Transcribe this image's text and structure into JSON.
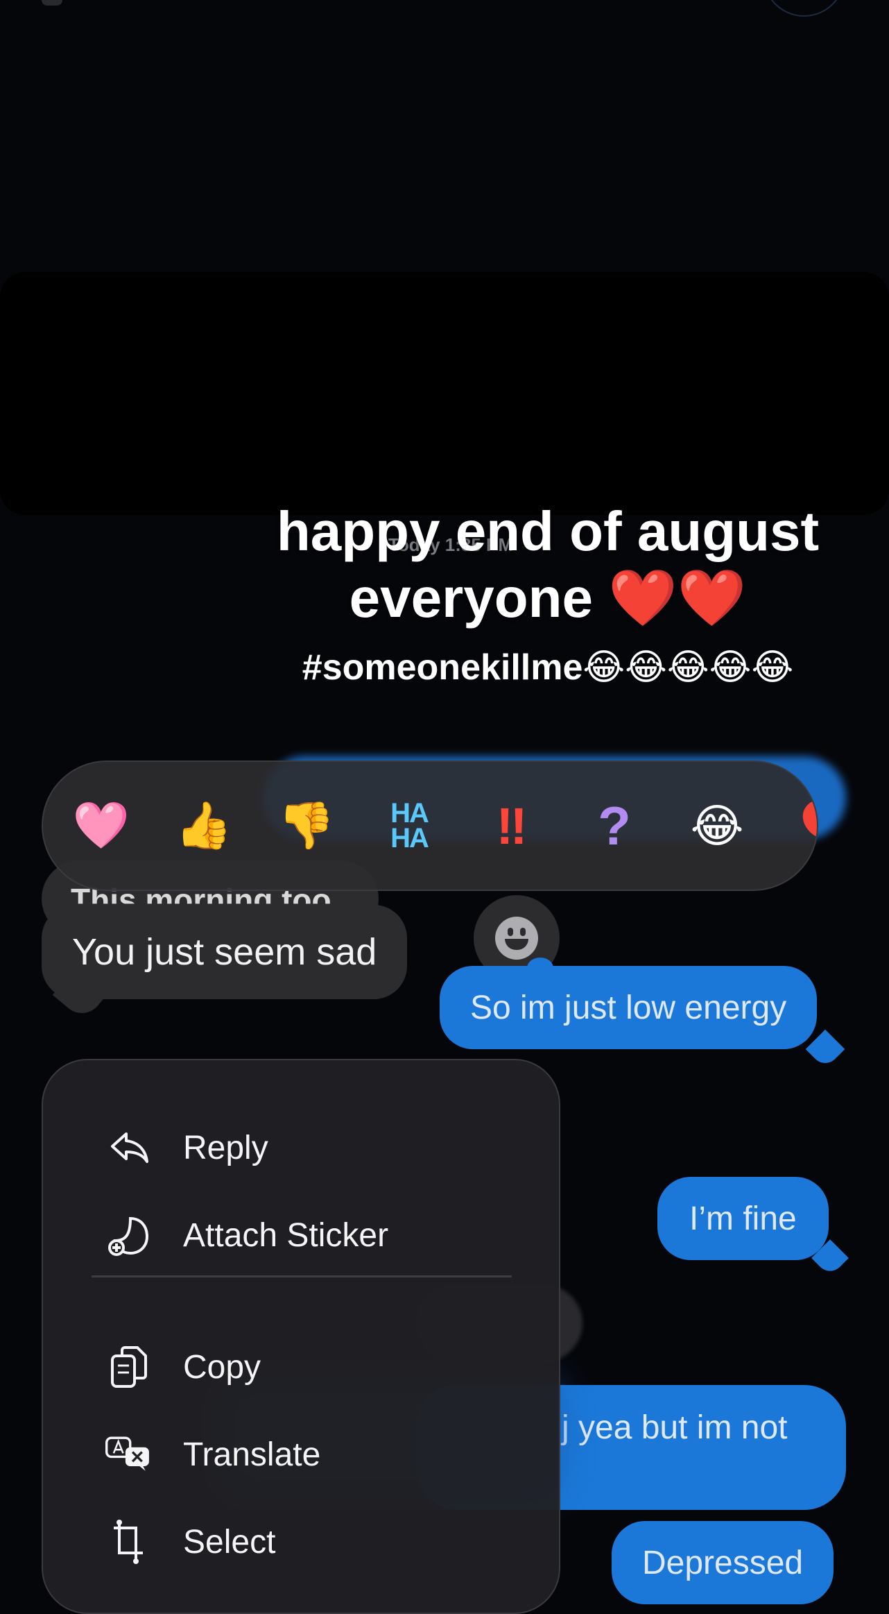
{
  "overlay": {
    "timestamp": "Today 1:35 PM",
    "caption_line1": "happy end of august",
    "caption_line2": "everyone ❤️❤️",
    "hashtag": "#someonekillme😂😂😂😂😂"
  },
  "reactions": {
    "heart": "🩷",
    "thumbs_up": "👍",
    "thumbs_down": "👎",
    "haha_top": "HA",
    "haha_bottom": "HA",
    "emphasize": "‼",
    "question": "?",
    "laugh": "😂",
    "balloon": "🎈"
  },
  "messages": {
    "partial_received": "This morning too",
    "received_sad": "You just seem sad",
    "sent_low_energy": "So im just low energy",
    "sent_fine": "I’m fine",
    "sent_yea": "j yea but im not",
    "sent_depressed": "Depressed"
  },
  "context_menu": {
    "reply": "Reply",
    "attach_sticker": "Attach Sticker",
    "copy": "Copy",
    "translate": "Translate",
    "select": "Select"
  },
  "colors": {
    "sent_bubble": "#1b78d8",
    "received_bubble": "#2c2c2f",
    "background": "#05060a"
  }
}
